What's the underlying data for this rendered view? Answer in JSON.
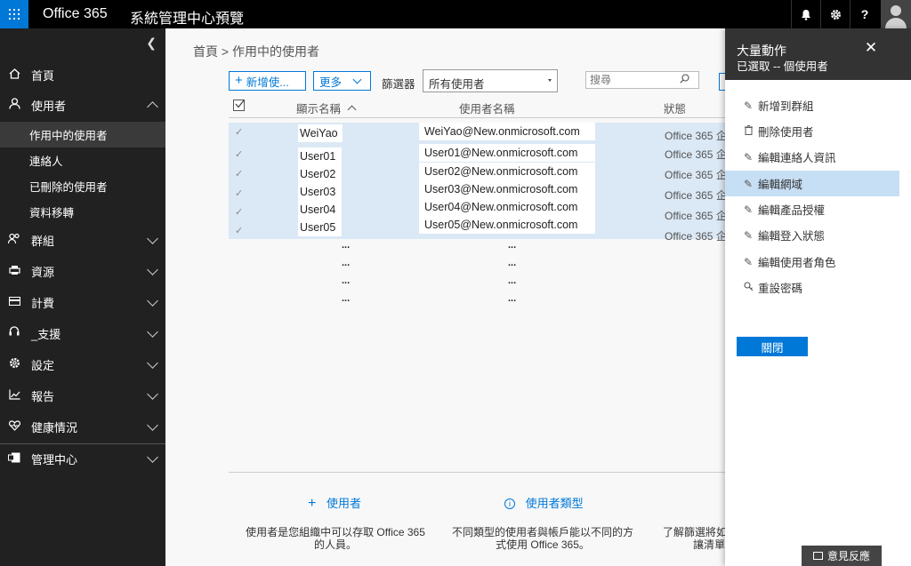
{
  "topbar": {
    "brand": "Office 365",
    "title": "系統管理中心預覽",
    "notification_icon": "bell-icon",
    "settings_icon": "gear-icon",
    "help_label": "?"
  },
  "sidebar": {
    "home": "首頁",
    "users": "使用者",
    "users_sub": [
      "作用中的使用者",
      "連絡人",
      "已刪除的使用者",
      "資料移轉"
    ],
    "groups": "群組",
    "resources": "資源",
    "billing": "計費",
    "support": "_支援",
    "settings": "設定",
    "reports": "報告",
    "health": "健康情況",
    "admin_centers": "管理中心"
  },
  "main": {
    "breadcrumb": "首頁 > 作用中的使用者",
    "add_user": "新增使...",
    "more": "更多",
    "filter_label": "篩選器",
    "filter_value": "所有使用者",
    "search_placeholder": "搜尋",
    "columns": {
      "display_name": "顯示名稱",
      "upn": "使用者名稱",
      "status": "狀態"
    },
    "rows": [
      {
        "name": "WeiYao",
        "upn": "WeiYao@New.onmicrosoft.com",
        "status": "Office 365 企"
      },
      {
        "name": "User01",
        "upn": "User01@New.onmicrosoft.com",
        "status": "Office 365 企"
      },
      {
        "name": "User02",
        "upn": "User02@New.onmicrosoft.com",
        "status": "Office 365 企"
      },
      {
        "name": "User03",
        "upn": "User03@New.onmicrosoft.com",
        "status": "Office 365 企"
      },
      {
        "name": "User04",
        "upn": "User04@New.onmicrosoft.com",
        "status": "Office 365 企"
      },
      {
        "name": "User05",
        "upn": "User05@New.onmicrosoft.com",
        "status": "Office 365 企"
      }
    ],
    "ellipsis": "...",
    "info": {
      "users_title": "使用者",
      "users_desc_1": "使用者是您組織中可以存取 Office 365",
      "users_desc_2": "的人員。",
      "types_title": "使用者類型",
      "types_desc_1": "不同類型的使用者與帳戶能以不同的方",
      "types_desc_2": "式使用 Office 365。",
      "filter_desc_1": "了解篩選將如",
      "filter_desc_2": "讓清單"
    }
  },
  "panel": {
    "title": "大量動作",
    "subtitle": "已選取 -- 個使用者",
    "actions": [
      "新增到群組",
      "刪除使用者",
      "編輯連絡人資訊",
      "編輯網域",
      "編輯產品授權",
      "編輯登入狀態",
      "編輯使用者角色",
      "重設密碼"
    ],
    "close_label": "關閉",
    "feedback": "意見反應"
  }
}
